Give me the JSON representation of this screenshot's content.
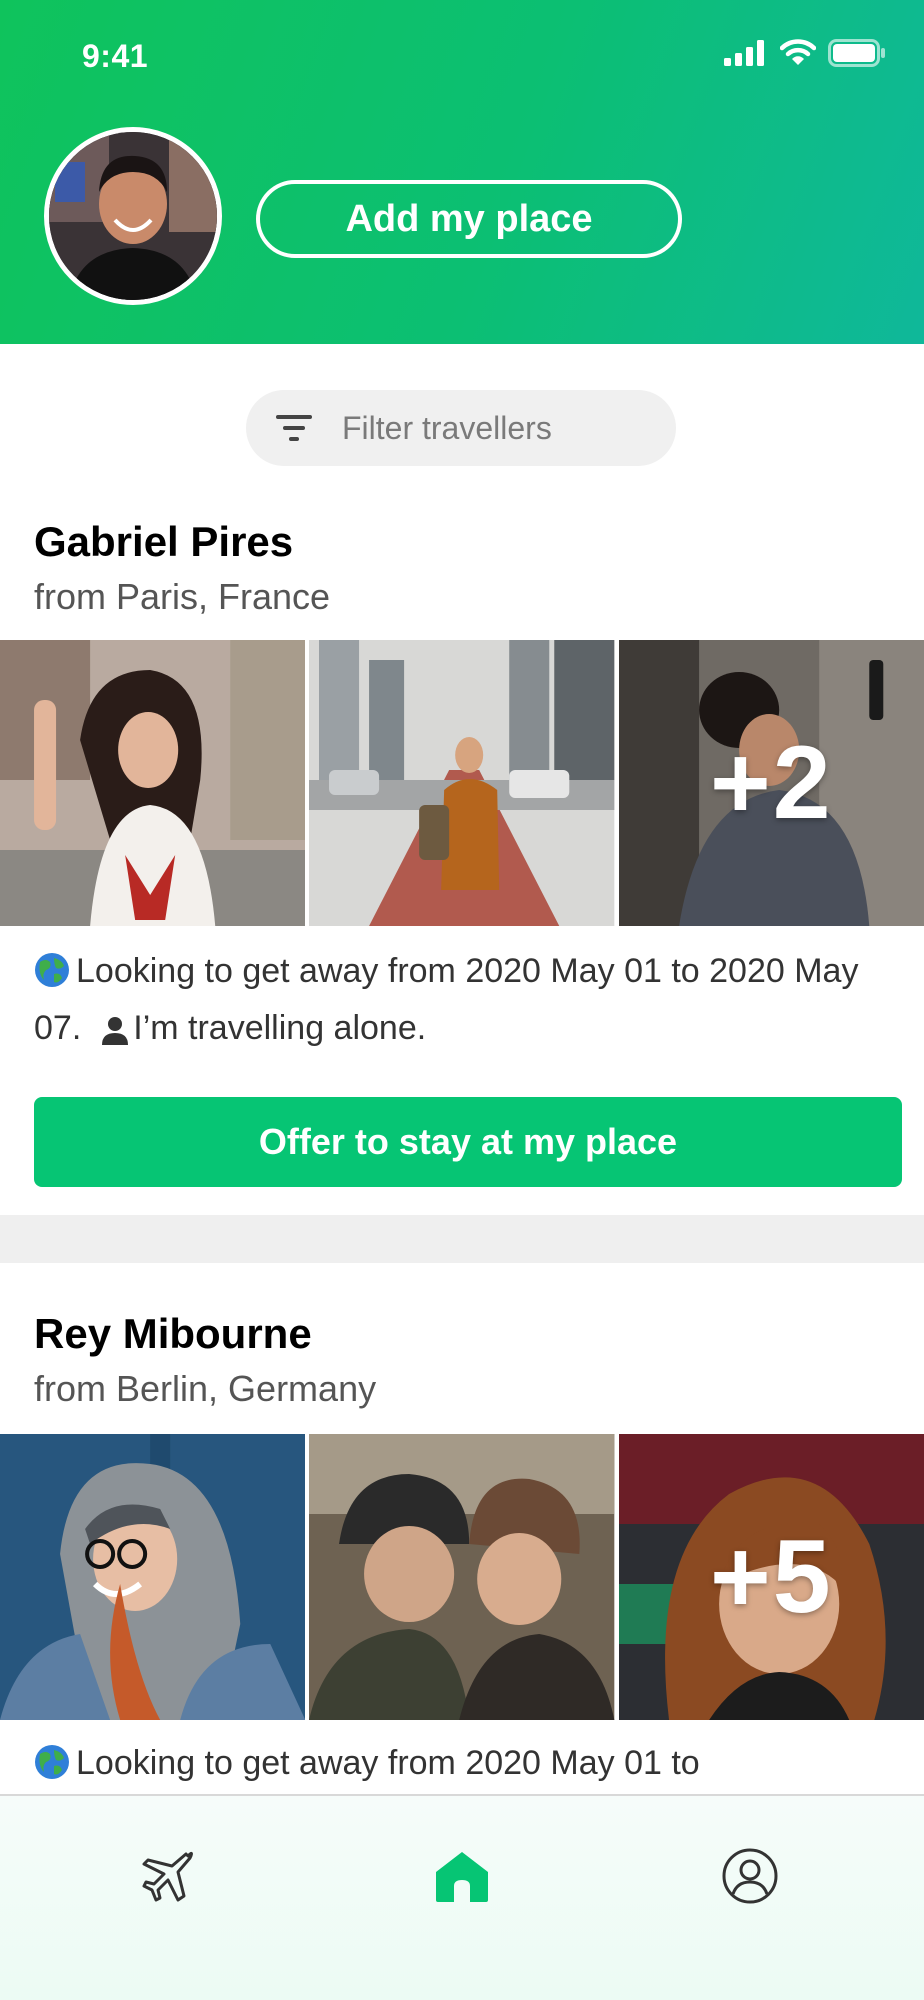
{
  "status_bar": {
    "time": "9:41"
  },
  "header": {
    "add_place_label": "Add my place",
    "accent": "#0fc35c"
  },
  "filter": {
    "label": "Filter travellers"
  },
  "travellers": [
    {
      "name": "Gabriel Pires",
      "from": "from Paris, France",
      "more_photos": "+2",
      "trip_text": "Looking to get away from 2020 May 01 to 2020 May 07.",
      "companions": "I’m travelling alone.",
      "offer_label": "Offer to stay at my place"
    },
    {
      "name": "Rey Mibourne",
      "from": "from Berlin, Germany",
      "more_photos": "+5",
      "trip_text": "Looking to get away from 2020 May 01 to"
    }
  ],
  "nav": {
    "items": [
      "plane-icon",
      "home-icon",
      "profile-icon"
    ],
    "active": "home-icon",
    "active_color": "#06c574"
  }
}
